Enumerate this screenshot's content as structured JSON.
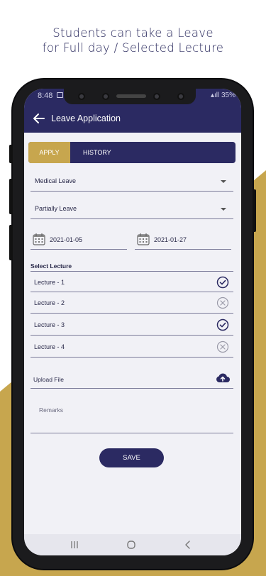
{
  "promo": {
    "line1": "Students can take a Leave",
    "line2": "for Full day / Selected Lecture"
  },
  "status_bar": {
    "time": "8:48",
    "battery": "35%"
  },
  "app_bar": {
    "title": "Leave Application",
    "back_icon": "arrow-left-icon"
  },
  "tabs": [
    {
      "label": "APPLY",
      "active": true
    },
    {
      "label": "HISTORY",
      "active": false
    }
  ],
  "form": {
    "leave_type": "Medical Leave",
    "leave_duration": "Partially Leave",
    "from_date": "2021-01-05",
    "to_date": "2021-01-27",
    "select_lecture_label": "Select Lecture",
    "lectures": [
      {
        "label": "Lecture - 1",
        "selected": true
      },
      {
        "label": "Lecture - 2",
        "selected": false
      },
      {
        "label": "Lecture - 3",
        "selected": true
      },
      {
        "label": "Lecture - 4",
        "selected": false
      }
    ],
    "upload_label": "Upload File",
    "remarks_placeholder": "Remarks",
    "save_label": "SAVE"
  },
  "colors": {
    "primary": "#2b2a62",
    "accent": "#c7a64e"
  }
}
